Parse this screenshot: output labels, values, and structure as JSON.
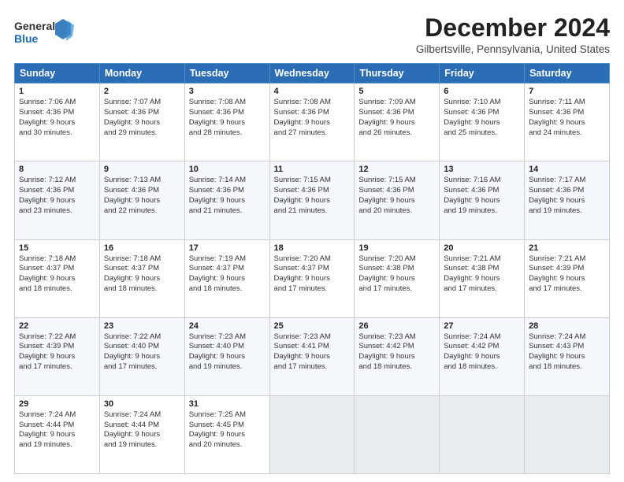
{
  "header": {
    "logo": {
      "line1": "General",
      "line2": "Blue"
    },
    "title": "December 2024",
    "location": "Gilbertsville, Pennsylvania, United States"
  },
  "days_of_week": [
    "Sunday",
    "Monday",
    "Tuesday",
    "Wednesday",
    "Thursday",
    "Friday",
    "Saturday"
  ],
  "weeks": [
    [
      {
        "day": 1,
        "lines": [
          "Sunrise: 7:06 AM",
          "Sunset: 4:36 PM",
          "Daylight: 9 hours",
          "and 30 minutes."
        ]
      },
      {
        "day": 2,
        "lines": [
          "Sunrise: 7:07 AM",
          "Sunset: 4:36 PM",
          "Daylight: 9 hours",
          "and 29 minutes."
        ]
      },
      {
        "day": 3,
        "lines": [
          "Sunrise: 7:08 AM",
          "Sunset: 4:36 PM",
          "Daylight: 9 hours",
          "and 28 minutes."
        ]
      },
      {
        "day": 4,
        "lines": [
          "Sunrise: 7:08 AM",
          "Sunset: 4:36 PM",
          "Daylight: 9 hours",
          "and 27 minutes."
        ]
      },
      {
        "day": 5,
        "lines": [
          "Sunrise: 7:09 AM",
          "Sunset: 4:36 PM",
          "Daylight: 9 hours",
          "and 26 minutes."
        ]
      },
      {
        "day": 6,
        "lines": [
          "Sunrise: 7:10 AM",
          "Sunset: 4:36 PM",
          "Daylight: 9 hours",
          "and 25 minutes."
        ]
      },
      {
        "day": 7,
        "lines": [
          "Sunrise: 7:11 AM",
          "Sunset: 4:36 PM",
          "Daylight: 9 hours",
          "and 24 minutes."
        ]
      }
    ],
    [
      {
        "day": 8,
        "lines": [
          "Sunrise: 7:12 AM",
          "Sunset: 4:36 PM",
          "Daylight: 9 hours",
          "and 23 minutes."
        ]
      },
      {
        "day": 9,
        "lines": [
          "Sunrise: 7:13 AM",
          "Sunset: 4:36 PM",
          "Daylight: 9 hours",
          "and 22 minutes."
        ]
      },
      {
        "day": 10,
        "lines": [
          "Sunrise: 7:14 AM",
          "Sunset: 4:36 PM",
          "Daylight: 9 hours",
          "and 21 minutes."
        ]
      },
      {
        "day": 11,
        "lines": [
          "Sunrise: 7:15 AM",
          "Sunset: 4:36 PM",
          "Daylight: 9 hours",
          "and 21 minutes."
        ]
      },
      {
        "day": 12,
        "lines": [
          "Sunrise: 7:15 AM",
          "Sunset: 4:36 PM",
          "Daylight: 9 hours",
          "and 20 minutes."
        ]
      },
      {
        "day": 13,
        "lines": [
          "Sunrise: 7:16 AM",
          "Sunset: 4:36 PM",
          "Daylight: 9 hours",
          "and 19 minutes."
        ]
      },
      {
        "day": 14,
        "lines": [
          "Sunrise: 7:17 AM",
          "Sunset: 4:36 PM",
          "Daylight: 9 hours",
          "and 19 minutes."
        ]
      }
    ],
    [
      {
        "day": 15,
        "lines": [
          "Sunrise: 7:18 AM",
          "Sunset: 4:37 PM",
          "Daylight: 9 hours",
          "and 18 minutes."
        ]
      },
      {
        "day": 16,
        "lines": [
          "Sunrise: 7:18 AM",
          "Sunset: 4:37 PM",
          "Daylight: 9 hours",
          "and 18 minutes."
        ]
      },
      {
        "day": 17,
        "lines": [
          "Sunrise: 7:19 AM",
          "Sunset: 4:37 PM",
          "Daylight: 9 hours",
          "and 18 minutes."
        ]
      },
      {
        "day": 18,
        "lines": [
          "Sunrise: 7:20 AM",
          "Sunset: 4:37 PM",
          "Daylight: 9 hours",
          "and 17 minutes."
        ]
      },
      {
        "day": 19,
        "lines": [
          "Sunrise: 7:20 AM",
          "Sunset: 4:38 PM",
          "Daylight: 9 hours",
          "and 17 minutes."
        ]
      },
      {
        "day": 20,
        "lines": [
          "Sunrise: 7:21 AM",
          "Sunset: 4:38 PM",
          "Daylight: 9 hours",
          "and 17 minutes."
        ]
      },
      {
        "day": 21,
        "lines": [
          "Sunrise: 7:21 AM",
          "Sunset: 4:39 PM",
          "Daylight: 9 hours",
          "and 17 minutes."
        ]
      }
    ],
    [
      {
        "day": 22,
        "lines": [
          "Sunrise: 7:22 AM",
          "Sunset: 4:39 PM",
          "Daylight: 9 hours",
          "and 17 minutes."
        ]
      },
      {
        "day": 23,
        "lines": [
          "Sunrise: 7:22 AM",
          "Sunset: 4:40 PM",
          "Daylight: 9 hours",
          "and 17 minutes."
        ]
      },
      {
        "day": 24,
        "lines": [
          "Sunrise: 7:23 AM",
          "Sunset: 4:40 PM",
          "Daylight: 9 hours",
          "and 19 minutes."
        ]
      },
      {
        "day": 25,
        "lines": [
          "Sunrise: 7:23 AM",
          "Sunset: 4:41 PM",
          "Daylight: 9 hours",
          "and 17 minutes."
        ]
      },
      {
        "day": 26,
        "lines": [
          "Sunrise: 7:23 AM",
          "Sunset: 4:42 PM",
          "Daylight: 9 hours",
          "and 18 minutes."
        ]
      },
      {
        "day": 27,
        "lines": [
          "Sunrise: 7:24 AM",
          "Sunset: 4:42 PM",
          "Daylight: 9 hours",
          "and 18 minutes."
        ]
      },
      {
        "day": 28,
        "lines": [
          "Sunrise: 7:24 AM",
          "Sunset: 4:43 PM",
          "Daylight: 9 hours",
          "and 18 minutes."
        ]
      }
    ],
    [
      {
        "day": 29,
        "lines": [
          "Sunrise: 7:24 AM",
          "Sunset: 4:44 PM",
          "Daylight: 9 hours",
          "and 19 minutes."
        ]
      },
      {
        "day": 30,
        "lines": [
          "Sunrise: 7:24 AM",
          "Sunset: 4:44 PM",
          "Daylight: 9 hours",
          "and 19 minutes."
        ]
      },
      {
        "day": 31,
        "lines": [
          "Sunrise: 7:25 AM",
          "Sunset: 4:45 PM",
          "Daylight: 9 hours",
          "and 20 minutes."
        ]
      },
      null,
      null,
      null,
      null
    ]
  ]
}
